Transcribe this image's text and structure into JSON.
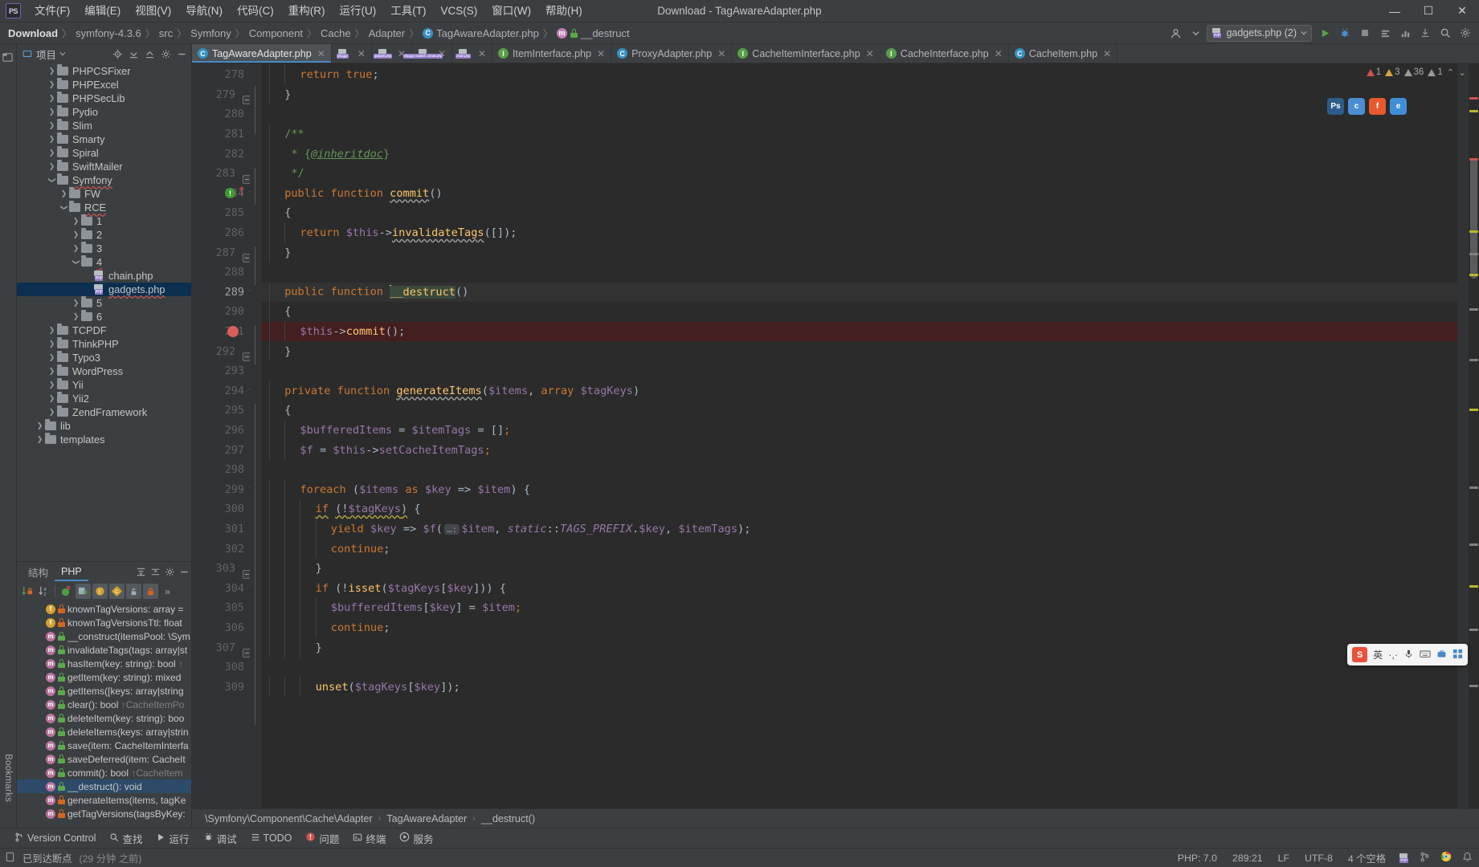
{
  "window": {
    "title": "Download - TagAwareAdapter.php",
    "logo": "PS",
    "controls": {
      "minimize": "—",
      "maximize": "☐",
      "close": "✕"
    }
  },
  "menu": [
    {
      "label": "文件(F)",
      "name": "menu-file"
    },
    {
      "label": "编辑(E)",
      "name": "menu-edit"
    },
    {
      "label": "视图(V)",
      "name": "menu-view"
    },
    {
      "label": "导航(N)",
      "name": "menu-navigate"
    },
    {
      "label": "代码(C)",
      "name": "menu-code"
    },
    {
      "label": "重构(R)",
      "name": "menu-refactor"
    },
    {
      "label": "运行(U)",
      "name": "menu-run"
    },
    {
      "label": "工具(T)",
      "name": "menu-tools"
    },
    {
      "label": "VCS(S)",
      "name": "menu-vcs"
    },
    {
      "label": "窗口(W)",
      "name": "menu-window"
    },
    {
      "label": "帮助(H)",
      "name": "menu-help"
    }
  ],
  "breadcrumb": {
    "items": [
      "Download",
      "symfony-4.3.6",
      "src",
      "Symfony",
      "Component",
      "Cache",
      "Adapter"
    ],
    "file": "TagAwareAdapter.php",
    "member": "__destruct",
    "separator": "〉"
  },
  "toolbar": {
    "run_config": "gadgets.php (2)",
    "run_title": "运行",
    "debug_title": "调试",
    "stop_title": "停止",
    "search_title": "搜索",
    "settings_title": "设置",
    "user_title": "账户"
  },
  "sidebar": {
    "project_tab": "项目",
    "vertical_tabs": [
      "Bookmarks"
    ],
    "tree": [
      {
        "label": "PHPCSFixer",
        "indent": 3,
        "type": "folder",
        "expanded": false
      },
      {
        "label": "PHPExcel",
        "indent": 3,
        "type": "folder",
        "expanded": false
      },
      {
        "label": "PHPSecLib",
        "indent": 3,
        "type": "folder",
        "expanded": false
      },
      {
        "label": "Pydio",
        "indent": 3,
        "type": "folder",
        "expanded": false
      },
      {
        "label": "Slim",
        "indent": 3,
        "type": "folder",
        "expanded": false
      },
      {
        "label": "Smarty",
        "indent": 3,
        "type": "folder",
        "expanded": false
      },
      {
        "label": "Spiral",
        "indent": 3,
        "type": "folder",
        "expanded": false
      },
      {
        "label": "SwiftMailer",
        "indent": 3,
        "type": "folder",
        "expanded": false
      },
      {
        "label": "Symfony",
        "indent": 3,
        "type": "folder",
        "expanded": true,
        "squiggle": true
      },
      {
        "label": "FW",
        "indent": 4,
        "type": "folder",
        "expanded": false
      },
      {
        "label": "RCE",
        "indent": 4,
        "type": "folder",
        "expanded": true,
        "squiggle": true
      },
      {
        "label": "1",
        "indent": 5,
        "type": "folder",
        "expanded": false
      },
      {
        "label": "2",
        "indent": 5,
        "type": "folder",
        "expanded": false
      },
      {
        "label": "3",
        "indent": 5,
        "type": "folder",
        "expanded": false
      },
      {
        "label": "4",
        "indent": 5,
        "type": "folder",
        "expanded": true,
        "squiggle": true
      },
      {
        "label": "chain.php",
        "indent": 6,
        "type": "php"
      },
      {
        "label": "gadgets.php",
        "indent": 6,
        "type": "php",
        "selected": true,
        "squiggle": true
      },
      {
        "label": "5",
        "indent": 5,
        "type": "folder",
        "expanded": false
      },
      {
        "label": "6",
        "indent": 5,
        "type": "folder",
        "expanded": false
      },
      {
        "label": "TCPDF",
        "indent": 3,
        "type": "folder",
        "expanded": false
      },
      {
        "label": "ThinkPHP",
        "indent": 3,
        "type": "folder",
        "expanded": false
      },
      {
        "label": "Typo3",
        "indent": 3,
        "type": "folder",
        "expanded": false
      },
      {
        "label": "WordPress",
        "indent": 3,
        "type": "folder",
        "expanded": false
      },
      {
        "label": "Yii",
        "indent": 3,
        "type": "folder",
        "expanded": false
      },
      {
        "label": "Yii2",
        "indent": 3,
        "type": "folder",
        "expanded": false
      },
      {
        "label": "ZendFramework",
        "indent": 3,
        "type": "folder",
        "expanded": false
      },
      {
        "label": "lib",
        "indent": 2,
        "type": "folder",
        "expanded": false
      },
      {
        "label": "templates",
        "indent": 2,
        "type": "folder",
        "expanded": false
      }
    ]
  },
  "structure": {
    "tabs": [
      {
        "label": "结构",
        "active": false
      },
      {
        "label": "PHP",
        "active": true
      }
    ],
    "items": [
      {
        "icon": "f",
        "vis": "priv",
        "text": "knownTagVersions: array =",
        "selected": false
      },
      {
        "icon": "f",
        "vis": "priv",
        "text": "knownTagVersionsTtl: float",
        "selected": false
      },
      {
        "icon": "m",
        "vis": "pub",
        "text": "__construct(itemsPool: \\Sym",
        "selected": false
      },
      {
        "icon": "m",
        "vis": "pub",
        "text": "invalidateTags(tags: array|st",
        "selected": false
      },
      {
        "icon": "m",
        "vis": "pub",
        "text": "hasItem(key: string): bool",
        "ret": "↑",
        "selected": false
      },
      {
        "icon": "m",
        "vis": "pub",
        "text": "getItem(key: string): mixed",
        "selected": false
      },
      {
        "icon": "m",
        "vis": "pub",
        "text": "getItems([keys: array|string",
        "selected": false
      },
      {
        "icon": "m",
        "vis": "pub",
        "text": "clear(): bool",
        "ret": "↑CacheItemPo",
        "selected": false
      },
      {
        "icon": "m",
        "vis": "pub",
        "text": "deleteItem(key: string): boo",
        "selected": false
      },
      {
        "icon": "m",
        "vis": "pub",
        "text": "deleteItems(keys: array|strin",
        "selected": false
      },
      {
        "icon": "m",
        "vis": "pub",
        "text": "save(item: CacheItemInterfa",
        "selected": false
      },
      {
        "icon": "m",
        "vis": "pub",
        "text": "saveDeferred(item: CacheIt",
        "selected": false
      },
      {
        "icon": "m",
        "vis": "pub",
        "text": "commit(): bool",
        "ret": "↑CacheItem",
        "selected": false
      },
      {
        "icon": "m",
        "vis": "pub",
        "text": "__destruct(): void",
        "selected": true
      },
      {
        "icon": "m",
        "vis": "priv",
        "text": "generateItems(items, tagKe",
        "selected": false
      },
      {
        "icon": "m",
        "vis": "priv",
        "text": "getTagVersions(tagsByKey:",
        "selected": false
      }
    ]
  },
  "editor": {
    "tabs": [
      {
        "label": "TagAwareAdapter.php",
        "icon": "class",
        "active": true
      },
      {
        "label": "phpggc",
        "icon": "php",
        "active": false,
        "squiggle": true
      },
      {
        "label": "gadgets.php",
        "icon": "php",
        "active": false,
        "squiggle": true
      },
      {
        "label": "phpggc-master\\...\\chain.php",
        "icon": "php",
        "active": false
      },
      {
        "label": "chain.php",
        "icon": "php",
        "active": false
      },
      {
        "label": "ItemInterface.php",
        "icon": "iface",
        "active": false
      },
      {
        "label": "ProxyAdapter.php",
        "icon": "class",
        "active": false
      },
      {
        "label": "CacheItemInterface.php",
        "icon": "iface",
        "active": false
      },
      {
        "label": "CacheInterface.php",
        "icon": "iface",
        "active": false
      },
      {
        "label": "CacheItem.php",
        "icon": "class",
        "active": false
      }
    ],
    "first_line": 278,
    "lines": [
      {
        "n": 278,
        "html": "<span class=\"kw\">return</span> <span class=\"kw\">true</span><span class=\"pln\">;</span>",
        "indent": 2,
        "fold": null
      },
      {
        "n": 279,
        "html": "<span class=\"pln\">}</span>",
        "indent": 1,
        "fold": "minus"
      },
      {
        "n": 280,
        "html": "",
        "indent": 0,
        "fold": null
      },
      {
        "n": 281,
        "html": "<span class=\"doc\">/**</span>",
        "indent": 1,
        "fold": "arrow"
      },
      {
        "n": 282,
        "html": "<span class=\"doc\"> * {</span><span class=\"tagd\">@inheritdoc</span><span class=\"doc\">}</span>",
        "indent": 1,
        "fold": null
      },
      {
        "n": 283,
        "html": "<span class=\"doc\"> */</span>",
        "indent": 1,
        "fold": "minus"
      },
      {
        "n": 284,
        "html": "<span class=\"kw\">public function</span> <span class=\"fn sq\">commit</span><span class=\"pln\">()</span>",
        "indent": 1,
        "fold": "arrow",
        "bulb": true,
        "override": true
      },
      {
        "n": 285,
        "html": "<span class=\"pln\">{</span>",
        "indent": 1,
        "fold": null
      },
      {
        "n": 286,
        "html": "<span class=\"kw\">return</span> <span class=\"var\">$this</span><span class=\"pln\">-&gt;</span><span class=\"fn sq\">invalidateTags</span><span class=\"pln\">([]);</span>",
        "indent": 2,
        "fold": null
      },
      {
        "n": 287,
        "html": "<span class=\"pln\">}</span>",
        "indent": 1,
        "fold": "minus"
      },
      {
        "n": 288,
        "html": "",
        "indent": 0,
        "fold": null
      },
      {
        "n": 289,
        "html": "<span class=\"kw\">public function</span> <span class=\"caret\"></span><span class=\"fn destruct-hl\">__destruct</span><span class=\"pln\">()</span>",
        "indent": 1,
        "fold": "arrow",
        "current": true
      },
      {
        "n": 290,
        "html": "<span class=\"pln\">{</span>",
        "indent": 1,
        "fold": null
      },
      {
        "n": 291,
        "html": "<span class=\"var\">$this</span><span class=\"pln\">-&gt;</span><span class=\"fn\">commit</span><span class=\"pln\">();</span>",
        "indent": 2,
        "fold": null,
        "breakpoint": true
      },
      {
        "n": 292,
        "html": "<span class=\"pln\">}</span>",
        "indent": 1,
        "fold": "minus"
      },
      {
        "n": 293,
        "html": "",
        "indent": 0,
        "fold": null
      },
      {
        "n": 294,
        "html": "<span class=\"kw\">private function</span> <span class=\"fn sq\">generateItems</span><span class=\"pln\">(</span><span class=\"var\">$items</span><span class=\"pln\">, </span><span class=\"kw\">array</span> <span class=\"var\">$tagKeys</span><span class=\"pln\">)</span>",
        "indent": 1,
        "fold": "arrow"
      },
      {
        "n": 295,
        "html": "<span class=\"pln\">{</span>",
        "indent": 1,
        "fold": null
      },
      {
        "n": 296,
        "html": "<span class=\"var\">$bufferedItems</span> <span class=\"pln\">=</span> <span class=\"var\">$itemTags</span> <span class=\"pln\">= []</span><span class=\"kw\">;</span>",
        "indent": 2,
        "fold": null
      },
      {
        "n": 297,
        "html": "<span class=\"var\">$f</span> <span class=\"pln\">=</span> <span class=\"var\">$this</span><span class=\"pln\">-&gt;</span><span class=\"var\">setCacheItemTags</span><span class=\"kw\">;</span>",
        "indent": 2,
        "fold": null
      },
      {
        "n": 298,
        "html": "",
        "indent": 0,
        "fold": null
      },
      {
        "n": 299,
        "html": "<span class=\"kw\">foreach</span> <span class=\"pln\">(</span><span class=\"var\">$items</span> <span class=\"kw\">as</span> <span class=\"var\">$key</span> <span class=\"pln\">=&gt;</span> <span class=\"var\">$item</span><span class=\"pln\">) {</span>",
        "indent": 2,
        "fold": "arrow"
      },
      {
        "n": 300,
        "html": "<span class=\"kw sqy\">if</span> <span class=\"pln sqy\">(!</span><span class=\"var sqy\">$tagKeys</span><span class=\"pln sqy\">)</span> <span class=\"pln\">{</span>",
        "indent": 3,
        "fold": null
      },
      {
        "n": 301,
        "html": "<span class=\"kw\">yield</span> <span class=\"var\">$key</span> <span class=\"pln\">=&gt;</span> <span class=\"var\">$f</span><span class=\"pln\">(</span><span class=\"inlay\">…:</span><span class=\"var\">$item</span><span class=\"pln\">, </span><span class=\"stc\">static</span><span class=\"pln\">::</span><span class=\"stc\">TAGS_PREFIX</span><span class=\"pln\">.</span><span class=\"var\">$key</span><span class=\"pln\">, </span><span class=\"var\">$itemTags</span><span class=\"pln\">);</span>",
        "indent": 4,
        "fold": null
      },
      {
        "n": 302,
        "html": "<span class=\"kw\">continue</span><span class=\"pln\">;</span>",
        "indent": 4,
        "fold": null
      },
      {
        "n": 303,
        "html": "<span class=\"pln\">}</span>",
        "indent": 3,
        "fold": "minus"
      },
      {
        "n": 304,
        "html": "<span class=\"kw\">if</span> <span class=\"pln\">(!</span><span class=\"fn\">isset</span><span class=\"pln\">(</span><span class=\"var\">$tagKeys</span><span class=\"pln\">[</span><span class=\"var\">$key</span><span class=\"pln\">])) {</span>",
        "indent": 3,
        "fold": "arrow"
      },
      {
        "n": 305,
        "html": "<span class=\"var\">$bufferedItems</span><span class=\"pln\">[</span><span class=\"var\">$key</span><span class=\"pln\">] =</span> <span class=\"var\">$item</span><span class=\"kw\">;</span>",
        "indent": 4,
        "fold": null
      },
      {
        "n": 306,
        "html": "<span class=\"kw\">continue</span><span class=\"pln\">;</span>",
        "indent": 4,
        "fold": null
      },
      {
        "n": 307,
        "html": "<span class=\"pln\">}</span>",
        "indent": 3,
        "fold": "minus"
      },
      {
        "n": 308,
        "html": "",
        "indent": 0,
        "fold": null
      },
      {
        "n": 309,
        "html": "<span class=\"fn\">unset</span><span class=\"pln\">(</span><span class=\"var\">$tagKeys</span><span class=\"pln\">[</span><span class=\"var\">$key</span><span class=\"pln\">]);</span>",
        "indent": 3,
        "fold": null
      }
    ],
    "inspections": {
      "errors": "1",
      "warnings": "3",
      "weak_warnings": "36",
      "typos": "1",
      "grammar": "1"
    },
    "crumbs": [
      "\\Symfony\\Component\\Cache\\Adapter",
      "TagAwareAdapter",
      "__destruct()"
    ]
  },
  "float_icons": [
    {
      "label": "Ps",
      "color": "#2b5d8a",
      "name": "photoshop-icon"
    },
    {
      "label": "c",
      "color": "#4a8fd4",
      "name": "chrome-icon"
    },
    {
      "label": "f",
      "color": "#e85a2c",
      "name": "firefox-icon"
    },
    {
      "label": "e",
      "color": "#3f8fd8",
      "name": "edge-icon"
    }
  ],
  "ime": {
    "logo": "S",
    "mode": "英",
    "items": [
      "·,·",
      "mic",
      "keyboard",
      "box",
      "grid"
    ]
  },
  "bottom_toolwindows": [
    {
      "label": "Version Control",
      "icon": "branch",
      "name": "toolwindow-version-control"
    },
    {
      "label": "查找",
      "icon": "search",
      "name": "toolwindow-find"
    },
    {
      "label": "运行",
      "icon": "play",
      "name": "toolwindow-run"
    },
    {
      "label": "调试",
      "icon": "bug",
      "name": "toolwindow-debug"
    },
    {
      "label": "TODO",
      "icon": "list",
      "name": "toolwindow-todo"
    },
    {
      "label": "问题",
      "icon": "error",
      "name": "toolwindow-problems"
    },
    {
      "label": "终端",
      "icon": "term",
      "name": "toolwindow-terminal"
    },
    {
      "label": "服务",
      "icon": "play2",
      "name": "toolwindow-services"
    }
  ],
  "statusbar": {
    "message": "已到达断点",
    "message_time": "(29 分钟 之前)",
    "php_version": "PHP: 7.0",
    "caret": "289:21",
    "line_sep": "LF",
    "encoding": "UTF-8",
    "indent": "4 个空格"
  }
}
